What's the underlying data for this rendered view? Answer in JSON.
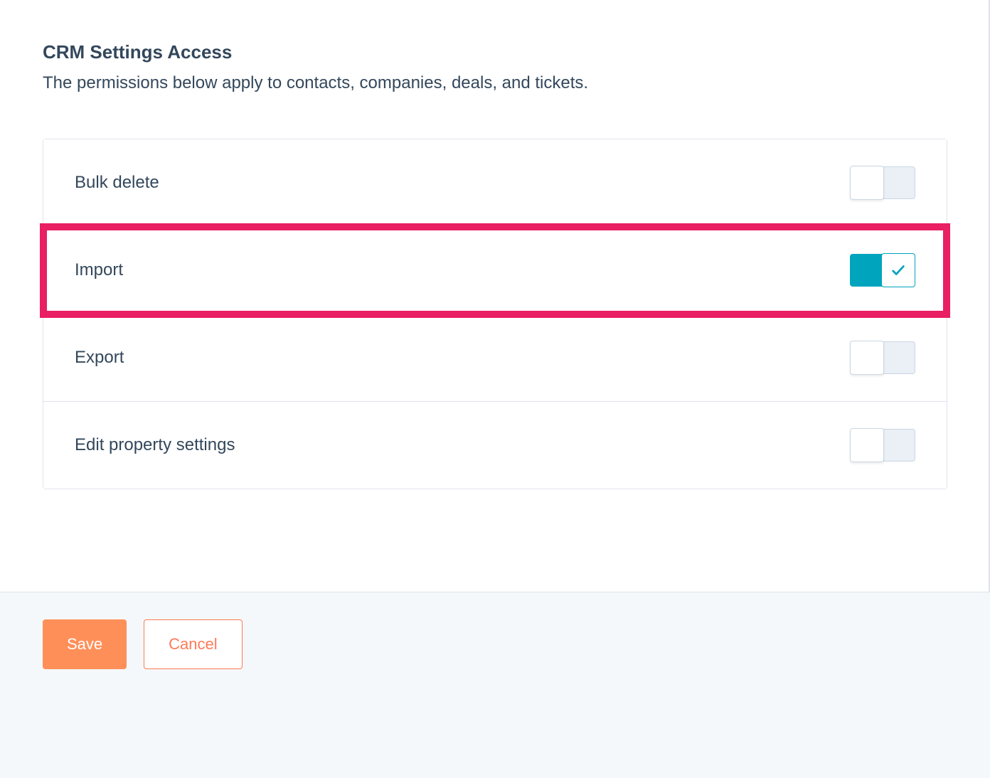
{
  "section": {
    "title": "CRM Settings Access",
    "description": "The permissions below apply to contacts, companies, deals, and tickets."
  },
  "permissions": [
    {
      "label": "Bulk delete",
      "enabled": false,
      "highlight": false
    },
    {
      "label": "Import",
      "enabled": true,
      "highlight": true
    },
    {
      "label": "Export",
      "enabled": false,
      "highlight": false
    },
    {
      "label": "Edit property settings",
      "enabled": false,
      "highlight": false
    }
  ],
  "footer": {
    "save_label": "Save",
    "cancel_label": "Cancel"
  },
  "colors": {
    "accent_teal": "#00a4bd",
    "accent_orange": "#ff7a59",
    "highlight_pink": "#e91e63",
    "text": "#33475b"
  }
}
